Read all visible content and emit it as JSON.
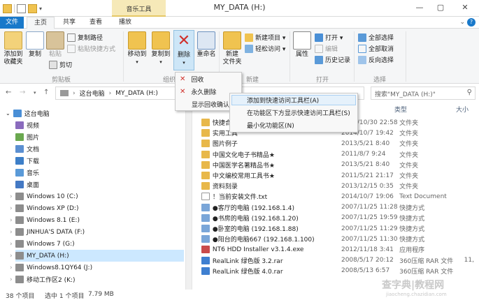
{
  "window": {
    "title": "MY_DATA (H:)",
    "context_tab_group": "音乐工具",
    "controls": [
      "—",
      "▢",
      "✕"
    ]
  },
  "tabs": [
    "文件",
    "主页",
    "共享",
    "查看",
    "播放"
  ],
  "ribbon": {
    "clipboard": {
      "pin": "添加到\n收藏夹",
      "copy": "复制",
      "paste": "粘贴",
      "copy_path": "复制路径",
      "paste_shortcut": "粘贴快捷方式",
      "cut": "剪切",
      "group": "剪贴板"
    },
    "organize": {
      "move_to": "移动到",
      "copy_to": "复制到",
      "delete": "删除",
      "rename": "重命名",
      "group": "组织"
    },
    "new": {
      "new_folder": "新建\n文件夹",
      "new_item": "新建项目 ▾",
      "easy_access": "轻松访问 ▾",
      "group": "新建"
    },
    "open": {
      "properties": "属性",
      "open": "打开 ▾",
      "edit": "编辑",
      "history": "历史记录",
      "group": "打开"
    },
    "select": {
      "select_all": "全部选择",
      "select_none": "全部取消",
      "invert": "反向选择",
      "group": "选择"
    }
  },
  "address": {
    "back": "←",
    "forward": "→",
    "up": "↑",
    "path": [
      "这台电脑",
      "›",
      "MY_DATA (H:)"
    ],
    "search_placeholder": "搜索\"MY_DATA (H:)\""
  },
  "nav": [
    {
      "label": "这台电脑",
      "icon": "computer-icon",
      "color": "#4a8fd6"
    },
    {
      "label": "视频",
      "icon": "video-folder-icon",
      "color": "#8a6bbd"
    },
    {
      "label": "图片",
      "icon": "pictures-folder-icon",
      "color": "#6aa84f"
    },
    {
      "label": "文档",
      "icon": "documents-folder-icon",
      "color": "#5b8fd1"
    },
    {
      "label": "下载",
      "icon": "downloads-folder-icon",
      "color": "#3d7fc8"
    },
    {
      "label": "音乐",
      "icon": "music-folder-icon",
      "color": "#5a9ad8"
    },
    {
      "label": "桌面",
      "icon": "desktop-folder-icon",
      "color": "#4479c4"
    },
    {
      "label": "Windows 10 (C:)",
      "icon": "drive-icon",
      "color": "#8d8d8d"
    },
    {
      "label": "Windows XP (D:)",
      "icon": "drive-icon",
      "color": "#8d8d8d"
    },
    {
      "label": "Windows 8.1 (E:)",
      "icon": "drive-icon",
      "color": "#8d8d8d"
    },
    {
      "label": "JINHUA'S DATA (F:)",
      "icon": "drive-icon",
      "color": "#8d8d8d"
    },
    {
      "label": "Windows 7 (G:)",
      "icon": "drive-icon",
      "color": "#8d8d8d"
    },
    {
      "label": "MY_DATA (H:)",
      "icon": "drive-icon",
      "color": "#8d8d8d"
    },
    {
      "label": "Windows8.1QY64 (J:)",
      "icon": "drive-icon",
      "color": "#8d8d8d"
    },
    {
      "label": "移动工作区2 (K:)",
      "icon": "drive-icon",
      "color": "#8d8d8d"
    }
  ],
  "columns": {
    "type": "类型",
    "size": "大小"
  },
  "files": [
    {
      "name": "快捷合集",
      "date": "2015/10/30 22:58",
      "type": "文件夹",
      "size": "",
      "icon": "folder-icon",
      "color": "#e8b84a"
    },
    {
      "name": "实用工具",
      "date": "2014/10/7 19:42",
      "type": "文件夹",
      "size": "",
      "icon": "folder-icon",
      "color": "#e8b84a"
    },
    {
      "name": "图片例子",
      "date": "2013/5/21 8:40",
      "type": "文件夹",
      "size": "",
      "icon": "folder-icon",
      "color": "#e8b84a"
    },
    {
      "name": "中国文化电子书精品★",
      "date": "2011/8/7 9:24",
      "type": "文件夹",
      "size": "",
      "icon": "folder-icon",
      "color": "#e8b84a"
    },
    {
      "name": "中国医学名著精品书★",
      "date": "2013/5/21 8:40",
      "type": "文件夹",
      "size": "",
      "icon": "folder-icon",
      "color": "#e8b84a"
    },
    {
      "name": "中文编校常用工具书★",
      "date": "2011/5/21 21:17",
      "type": "文件夹",
      "size": "",
      "icon": "folder-icon",
      "color": "#e8b84a"
    },
    {
      "name": "资料刻录",
      "date": "2013/12/15 0:35",
      "type": "文件夹",
      "size": "",
      "icon": "folder-icon",
      "color": "#e8b84a"
    },
    {
      "name": "！当前安装文件.txt",
      "date": "2014/10/7 19:06",
      "type": "Text Document",
      "size": "",
      "icon": "text-file-icon",
      "color": "#ffffff"
    },
    {
      "name": "●客厅的电脑 (192.168.1.4)",
      "date": "2007/11/25 11:28",
      "type": "快捷方式",
      "size": "",
      "icon": "shortcut-icon",
      "color": "#7aa6d8"
    },
    {
      "name": "●书房的电脑 (192.168.1.20)",
      "date": "2007/11/25 19:59",
      "type": "快捷方式",
      "size": "",
      "icon": "shortcut-icon",
      "color": "#7aa6d8"
    },
    {
      "name": "●卧室的电脑 (192.168.1.88)",
      "date": "2007/11/25 11:29",
      "type": "快捷方式",
      "size": "",
      "icon": "shortcut-icon",
      "color": "#7aa6d8"
    },
    {
      "name": "●阳台的电脑667 (192.168.1.100)",
      "date": "2007/11/25 11:30",
      "type": "快捷方式",
      "size": "",
      "icon": "shortcut-icon",
      "color": "#7aa6d8"
    },
    {
      "name": "NT6 HDD Installer v3.1.4.exe",
      "date": "2012/11/18 3:41",
      "type": "应用程序",
      "size": "",
      "icon": "exe-icon",
      "color": "#c94b4b"
    },
    {
      "name": "RealLink 绿色版 3.2.rar",
      "date": "2008/5/17 20:12",
      "type": "360压缩 RAR 文件",
      "size": "11,",
      "icon": "rar-icon",
      "color": "#3f7fd0"
    },
    {
      "name": "RealLink 绿色版 4.0.rar",
      "date": "2008/5/13 6:57",
      "type": "360压缩 RAR 文件",
      "size": "",
      "icon": "rar-icon",
      "color": "#3f7fd0"
    }
  ],
  "status": {
    "count": "38 个项目",
    "selection": "选中 1 个项目",
    "size": "7.79 MB"
  },
  "delete_menu": [
    "回收",
    "永久删除",
    "显示回收确认"
  ],
  "context_menu": [
    "添加到快速访问工具栏(A)",
    "在功能区下方显示快速访问工具栏(S)",
    "最小化功能区(N)"
  ],
  "watermark": {
    "main": "查字典|教程网",
    "sub": "jiaocheng.chazidian.com"
  }
}
